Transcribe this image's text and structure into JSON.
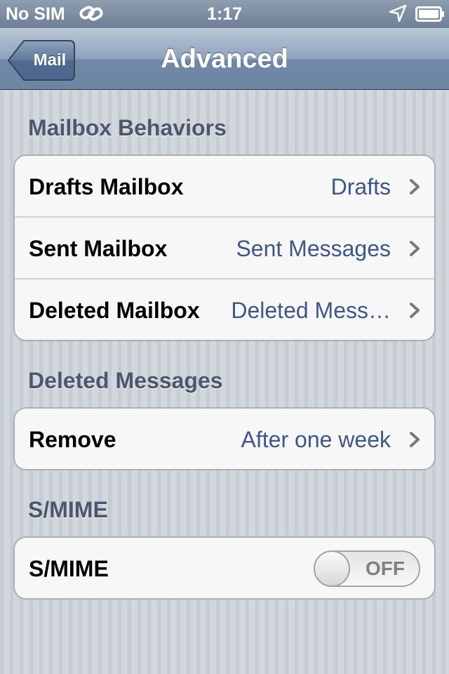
{
  "status_bar": {
    "carrier": "No SIM",
    "time": "1:17",
    "icons": [
      "link-icon",
      "location-arrow-icon",
      "battery-icon"
    ]
  },
  "nav": {
    "back_label": "Mail",
    "title": "Advanced"
  },
  "sections": [
    {
      "header": "Mailbox Behaviors",
      "rows": [
        {
          "label": "Drafts Mailbox",
          "value": "Drafts"
        },
        {
          "label": "Sent Mailbox",
          "value": "Sent Messages"
        },
        {
          "label": "Deleted Mailbox",
          "value": "Deleted Mess…"
        }
      ]
    },
    {
      "header": "Deleted Messages",
      "rows": [
        {
          "label": "Remove",
          "value": "After one week"
        }
      ]
    },
    {
      "header": "S/MIME",
      "rows": [
        {
          "label": "S/MIME",
          "toggle": "OFF",
          "toggle_on": false
        }
      ]
    }
  ],
  "colors": {
    "value_text": "#3f5686",
    "section_header": "#4c566c",
    "nav_bar": "#7189a7"
  }
}
